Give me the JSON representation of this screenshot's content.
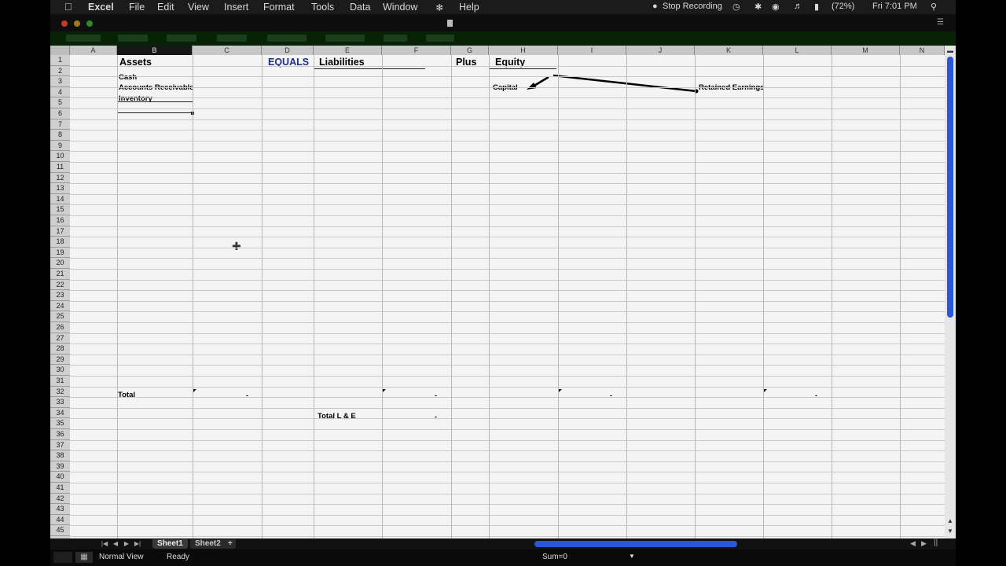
{
  "menubar": {
    "items": [
      "Excel",
      "File",
      "Edit",
      "View",
      "Insert",
      "Format",
      "Tools",
      "Data",
      "Window",
      "Help"
    ],
    "recording": "Stop Recording",
    "battery": "(72%)",
    "clock": "Fri 7:01 PM"
  },
  "grid": {
    "columns": [
      "A",
      "B",
      "C",
      "D",
      "E",
      "F",
      "G",
      "H",
      "I",
      "J",
      "K",
      "L",
      "M",
      "N"
    ],
    "selected_column": "B",
    "rows": [
      "1",
      "2",
      "3",
      "4",
      "5",
      "6",
      "7",
      "8",
      "9",
      "10",
      "11",
      "12",
      "13",
      "14",
      "15",
      "16",
      "17",
      "18",
      "19",
      "20",
      "21",
      "22",
      "23",
      "24",
      "25",
      "26",
      "27",
      "28",
      "29",
      "30",
      "31",
      "32",
      "33",
      "34",
      "35",
      "36",
      "37",
      "38",
      "39",
      "40",
      "41",
      "42",
      "43",
      "44",
      "45"
    ]
  },
  "cells": {
    "assets": "Assets",
    "equals": "EQUALS",
    "liabilities": "Liabilities",
    "plus": "Plus",
    "equity": "Equity",
    "cash": "Cash",
    "accounts_receivable": "Accounts Receivable",
    "inventory": "Inventory",
    "capital": "Capital",
    "retained_earnings": "Retained Earnings",
    "total": "Total",
    "total_le": "Total L & E",
    "dash": "-"
  },
  "sheets": {
    "tabs": [
      "Sheet1",
      "Sheet2"
    ],
    "active": "Sheet1",
    "add": "+"
  },
  "status": {
    "view": "Normal View",
    "state": "Ready",
    "sum": "Sum=0"
  },
  "colors": {
    "scroll_accent": "#2858d8",
    "header_blue": "#1a2f83"
  }
}
